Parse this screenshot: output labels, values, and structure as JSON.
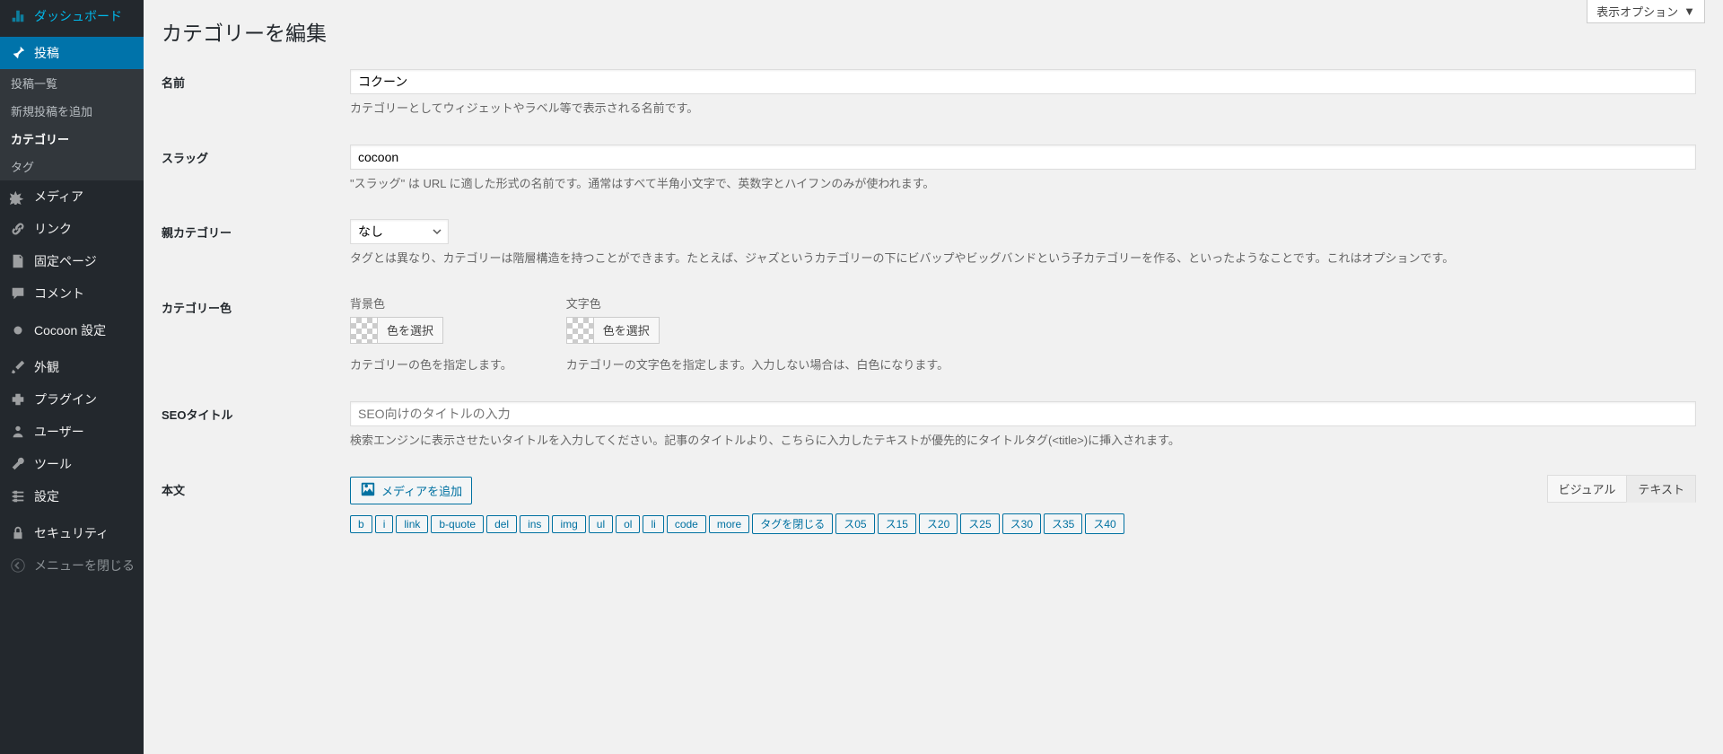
{
  "screen_options": "表示オプション",
  "page_title": "カテゴリーを編集",
  "sidebar": {
    "dashboard": "ダッシュボード",
    "posts": "投稿",
    "submenu": {
      "all": "投稿一覧",
      "new": "新規投稿を追加",
      "categories": "カテゴリー",
      "tags": "タグ"
    },
    "media": "メディア",
    "links": "リンク",
    "pages": "固定ページ",
    "comments": "コメント",
    "cocoon": "Cocoon 設定",
    "appearance": "外観",
    "plugins": "プラグイン",
    "users": "ユーザー",
    "tools": "ツール",
    "settings": "設定",
    "security": "セキュリティ",
    "collapse": "メニューを閉じる"
  },
  "fields": {
    "name": {
      "label": "名前",
      "value": "コクーン",
      "desc": "カテゴリーとしてウィジェットやラベル等で表示される名前です。"
    },
    "slug": {
      "label": "スラッグ",
      "value": "cocoon",
      "desc": "\"スラッグ\" は URL に適した形式の名前です。通常はすべて半角小文字で、英数字とハイフンのみが使われます。"
    },
    "parent": {
      "label": "親カテゴリー",
      "value": "なし",
      "desc": "タグとは異なり、カテゴリーは階層構造を持つことができます。たとえば、ジャズというカテゴリーの下にビバップやビッグバンドという子カテゴリーを作る、といったようなことです。これはオプションです。"
    },
    "color": {
      "label": "カテゴリー色",
      "bg_label": "背景色",
      "fg_label": "文字色",
      "picker_text": "色を選択",
      "bg_desc": "カテゴリーの色を指定します。",
      "fg_desc": "カテゴリーの文字色を指定します。入力しない場合は、白色になります。"
    },
    "seo_title": {
      "label": "SEOタイトル",
      "placeholder": "SEO向けのタイトルの入力",
      "desc": "検索エンジンに表示させたいタイトルを入力してください。記事のタイトルより、こちらに入力したテキストが優先的にタイトルタグ(<title>)に挿入されます。"
    },
    "content": {
      "label": "本文",
      "add_media": "メディアを追加",
      "tab_visual": "ビジュアル",
      "tab_text": "テキスト",
      "quicktags": [
        "b",
        "i",
        "link",
        "b-quote",
        "del",
        "ins",
        "img",
        "ul",
        "ol",
        "li",
        "code",
        "more",
        "タグを閉じる",
        "ス05",
        "ス15",
        "ス20",
        "ス25",
        "ス30",
        "ス35",
        "ス40"
      ]
    }
  }
}
